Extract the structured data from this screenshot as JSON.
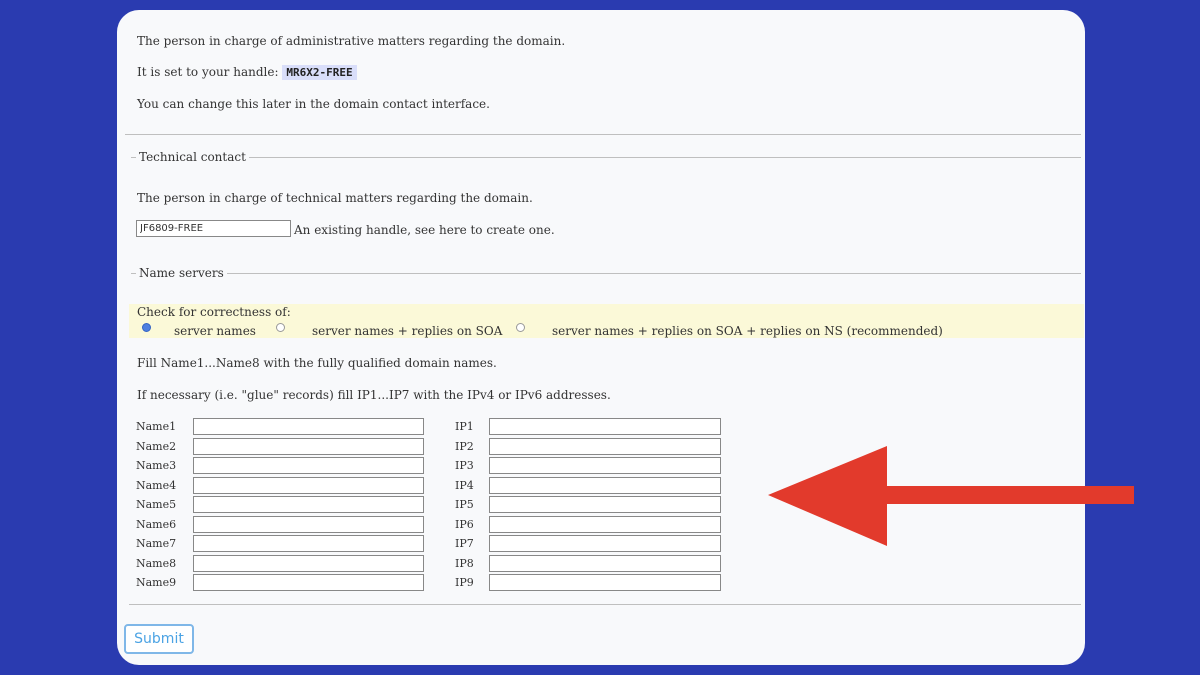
{
  "admin": {
    "desc": "The person in charge of administrative matters regarding the domain.",
    "handle_prefix": "It is set to your handle:",
    "handle": "MR6X2-FREE",
    "note": "You can change this later in the domain contact interface."
  },
  "technical": {
    "legend": "Technical contact",
    "desc": "The person in charge of technical matters regarding the domain.",
    "handle_value": "JF6809-FREE",
    "hint": "An existing handle, see here to create one."
  },
  "name_servers": {
    "legend": "Name servers",
    "check_label": "Check for correctness of:",
    "options": [
      "server names",
      "server names + replies on SOA",
      "server names + replies on SOA + replies on NS (recommended)"
    ],
    "selected_option": 0,
    "fill_text": "Fill Name1...Name8 with the fully qualified domain names.",
    "glue_text": "If necessary (i.e. \"glue\" records) fill IP1...IP7 with the IPv4 or IPv6 addresses.",
    "name_labels": [
      "Name1",
      "Name2",
      "Name3",
      "Name4",
      "Name5",
      "Name6",
      "Name7",
      "Name8",
      "Name9"
    ],
    "ip_labels": [
      "IP1",
      "IP2",
      "IP3",
      "IP4",
      "IP5",
      "IP6",
      "IP7",
      "IP8",
      "IP9"
    ]
  },
  "submit_label": "Submit",
  "colors": {
    "background": "#2a3bb0",
    "card": "#f8f9fb",
    "arrow": "#e23a2c",
    "highlight": "#fbf9d8"
  }
}
